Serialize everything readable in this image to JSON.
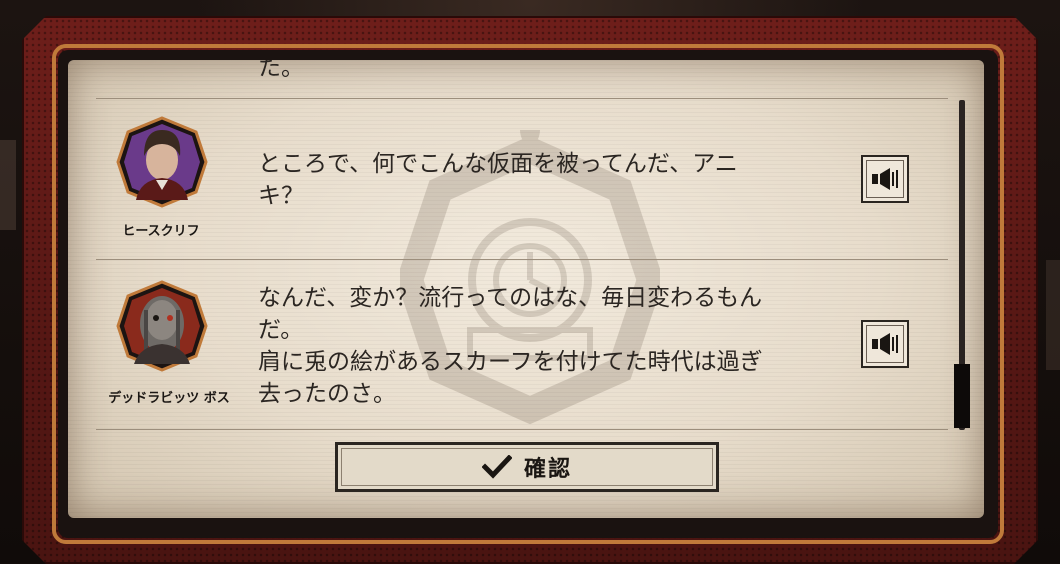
{
  "dialog_log": {
    "previous_line_tail": "た。",
    "entries": [
      {
        "speaker": "ヒースクリフ",
        "text_lines": [
          "ところで、何でこんな仮面を被ってんだ、アニ",
          "キ？"
        ]
      },
      {
        "speaker": "デッドラビッツ ボス",
        "text_lines": [
          "なんだ、変か？流行ってのはな、毎日変わるもん",
          "だ。",
          "肩に兎の絵があるスカーフを付けてた時代は過ぎ",
          "去ったのさ。"
        ]
      }
    ],
    "voice_icon": "speaker-icon",
    "confirm_label": "確認",
    "confirm_icon": "checkmark-icon"
  },
  "colors": {
    "frame_red": "#5e1a16",
    "trim_orange": "#c07a3a",
    "paper": "#e9dfce",
    "text_dark": "#2b2622"
  }
}
